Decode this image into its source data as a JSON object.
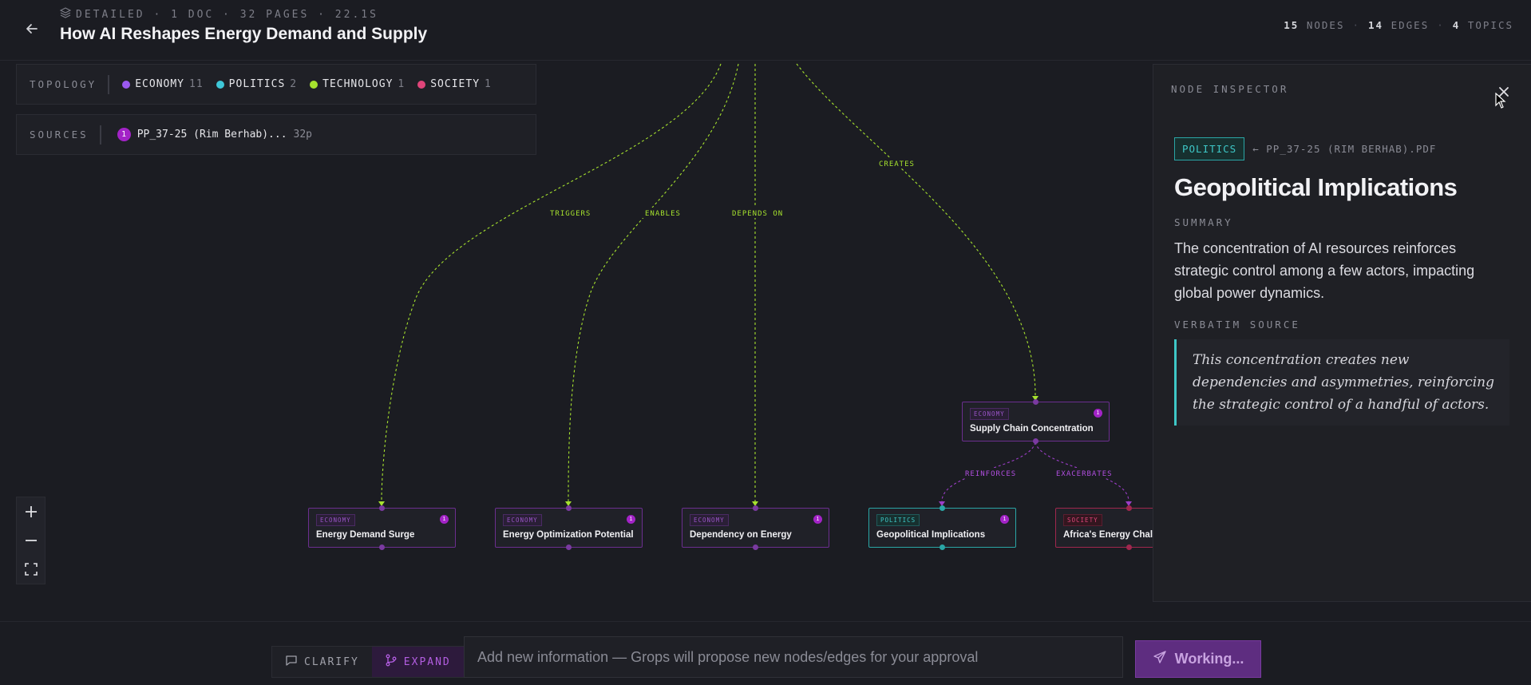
{
  "header": {
    "meta": "DETAILED · 1 DOC · 32 PAGES · 22.1S",
    "title": "How AI Reshapes Energy Demand and Supply",
    "stats": {
      "nodes": "15",
      "nodes_label": "NODES",
      "edges": "14",
      "edges_label": "EDGES",
      "topics": "4",
      "topics_label": "TOPICS"
    }
  },
  "topology": {
    "label": "TOPOLOGY",
    "topics": [
      {
        "name": "ECONOMY",
        "count": "11",
        "color": "#9b59f0"
      },
      {
        "name": "POLITICS",
        "count": "2",
        "color": "#3ec7d8"
      },
      {
        "name": "TECHNOLOGY",
        "count": "1",
        "color": "#a6e22e"
      },
      {
        "name": "SOCIETY",
        "count": "1",
        "color": "#e0457a"
      }
    ]
  },
  "sources": {
    "label": "SOURCES",
    "items": [
      {
        "num": "1",
        "name": "PP_37-25 (Rim Berhab)...",
        "pages": "32p"
      }
    ]
  },
  "edges": {
    "triggers": "TRIGGERS",
    "enables": "ENABLES",
    "depends_on": "DEPENDS ON",
    "creates": "CREATES",
    "reinforces": "REINFORCES",
    "exacerbates": "EXACERBATES"
  },
  "nodes": [
    {
      "topic": "ECONOMY",
      "name": "Supply Chain Concentration",
      "badge": "1"
    },
    {
      "topic": "ECONOMY",
      "name": "Energy Demand Surge",
      "badge": "1"
    },
    {
      "topic": "ECONOMY",
      "name": "Energy Optimization Potential",
      "badge": "1"
    },
    {
      "topic": "ECONOMY",
      "name": "Dependency on Energy",
      "badge": "1"
    },
    {
      "topic": "POLITICS",
      "name": "Geopolitical Implications",
      "badge": "1"
    },
    {
      "topic": "SOCIETY",
      "name": "Africa's Energy Challe",
      "badge": ""
    }
  ],
  "inspector": {
    "title": "NODE INSPECTOR",
    "tag": "POLITICS",
    "source": "← PP_37-25 (RIM BERHAB).PDF",
    "node_title": "Geopolitical Implications",
    "summary_label": "SUMMARY",
    "summary": "The concentration of AI resources reinforces strategic control among a few actors, impacting global power dynamics.",
    "verbatim_label": "VERBATIM SOURCE",
    "verbatim": "This concentration creates new dependencies and asymmetries, reinforcing the strategic control of a handful of actors."
  },
  "bottom": {
    "clarify": "CLARIFY",
    "expand": "EXPAND",
    "placeholder": "Add new information — Grops will propose new nodes/edges for your approval",
    "working": "Working..."
  },
  "colors": {
    "economy": "#6b2e8f",
    "politics": "#2aa6a6",
    "society": "#a0274e",
    "edge_green": "#a6e22e",
    "accent": "#5e2d80"
  }
}
